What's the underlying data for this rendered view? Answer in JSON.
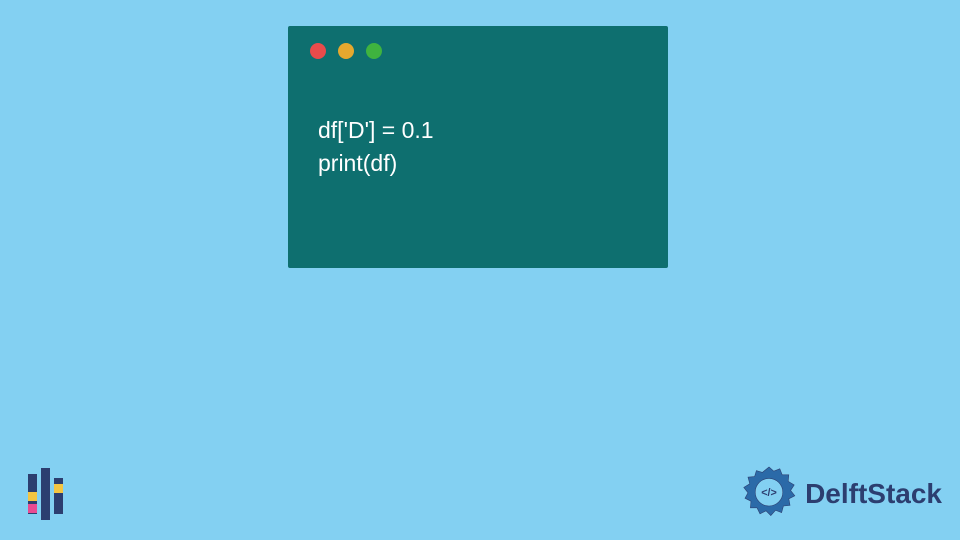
{
  "code": {
    "line1": "df['D'] = 0.1",
    "line2": "print(df)"
  },
  "brand": {
    "name": "DelftStack"
  },
  "colors": {
    "background": "#83d0f2",
    "window": "#0e6f6f",
    "text": "#ffffff",
    "brand_dark": "#2c3e70",
    "dot_red": "#e94b4b",
    "dot_yellow": "#e5a82e",
    "dot_green": "#3fb33f"
  }
}
